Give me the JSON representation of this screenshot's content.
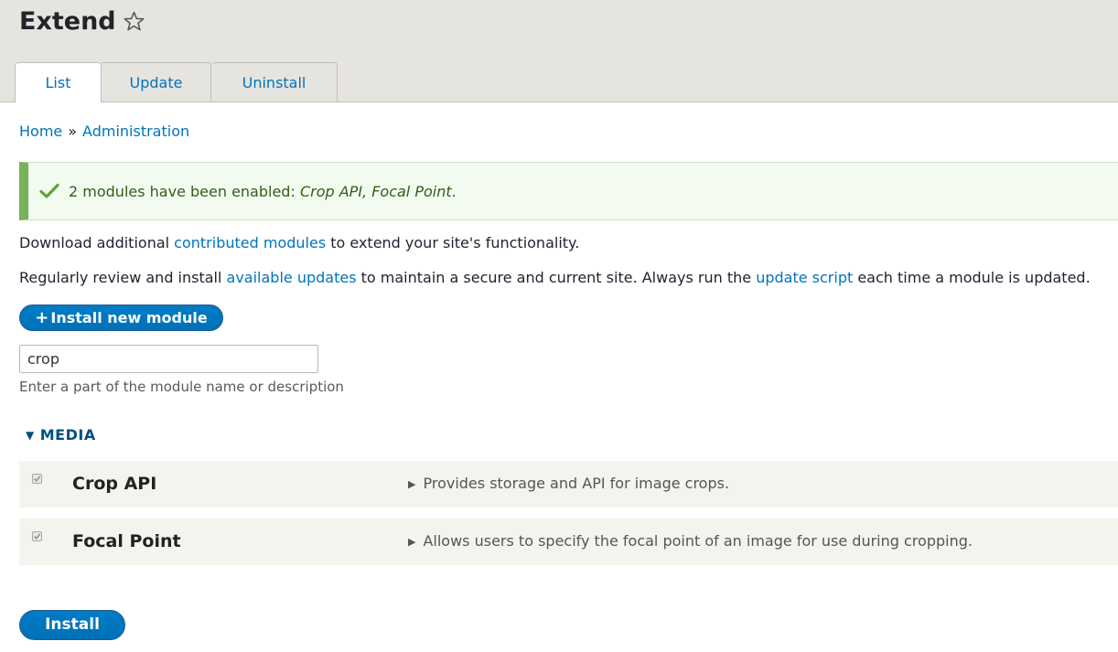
{
  "header": {
    "title": "Extend",
    "tabs": [
      {
        "label": "List",
        "active": true
      },
      {
        "label": "Update",
        "active": false
      },
      {
        "label": "Uninstall",
        "active": false
      }
    ]
  },
  "breadcrumb": {
    "home": "Home",
    "separator": "»",
    "admin": "Administration"
  },
  "status": {
    "prefix": "2 modules have been enabled: ",
    "modules": "Crop API, Focal Point",
    "suffix": "."
  },
  "intro": {
    "p1_before": "Download additional ",
    "p1_link": "contributed modules",
    "p1_after": " to extend your site's functionality.",
    "p2_before": "Regularly review and install ",
    "p2_link1": "available updates",
    "p2_mid": " to maintain a secure and current site. Always run the ",
    "p2_link2": "update script",
    "p2_after": " each time a module is updated."
  },
  "install_new_button": {
    "icon": "+",
    "label": "Install new module"
  },
  "filter": {
    "value": "crop",
    "description": "Enter a part of the module name or description"
  },
  "group": {
    "toggle_icon": "▼",
    "title": "MEDIA",
    "modules": [
      {
        "name": "Crop API",
        "description": "Provides storage and API for image crops.",
        "checked": true
      },
      {
        "name": "Focal Point",
        "description": "Allows users to specify the focal point of an image for use during cropping.",
        "checked": true
      }
    ]
  },
  "install_button": {
    "label": "Install"
  },
  "colors": {
    "link": "#0074bd",
    "header_bg": "#e6e4df",
    "status_accent": "#77b259",
    "primary_button": "#0071b8"
  }
}
